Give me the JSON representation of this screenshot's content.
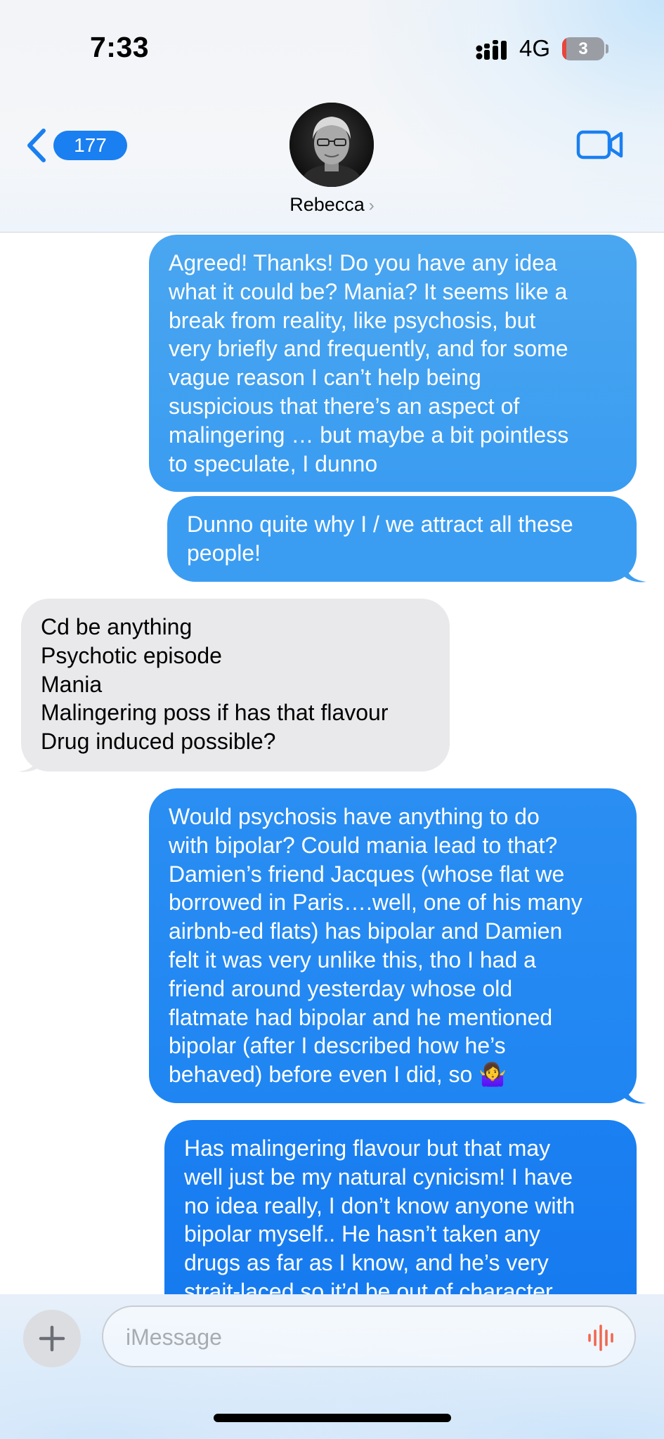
{
  "status_bar": {
    "time": "7:33",
    "network": "4G",
    "battery_level": "3",
    "signal_icon": "signal-bars-icon",
    "battery_icon": "battery-icon"
  },
  "header": {
    "back_count": "177",
    "back_icon": "chevron-left-icon",
    "contact_name": "Rebecca",
    "contact_chevron": "›",
    "video_icon": "video-camera-icon"
  },
  "messages": [
    {
      "direction": "outgoing",
      "text": "Agreed! Thanks! Do you have any idea\nwhat it could be? Mania? It seems like a\nbreak from reality, like psychosis, but\nvery briefly and frequently, and for some\nvague reason I can’t help being\nsuspicious that there’s an aspect of\nmalingering … but maybe a bit pointless\nto speculate, I dunno"
    },
    {
      "direction": "outgoing",
      "text": "Dunno quite why I / we attract all these\npeople!"
    },
    {
      "direction": "incoming",
      "text": "Cd be anything\nPsychotic episode\nMania\nMalingering poss if has that flavour\nDrug induced possible?"
    },
    {
      "direction": "outgoing",
      "text": "Would psychosis have anything to do\nwith bipolar? Could mania lead to that?\nDamien’s friend Jacques (whose flat we\nborrowed in Paris….well, one of his many\nairbnb-ed flats) has bipolar and Damien\nfelt it was very unlike this, tho I had a\nfriend around yesterday whose old\nflatmate had bipolar and he mentioned\nbipolar (after I described how he’s\nbehaved) before even I did, so 🤷‍♀️"
    },
    {
      "direction": "outgoing",
      "text": "Has malingering flavour but that may\nwell just be my natural cynicism! I have\nno idea really, I don’t know anyone with\nbipolar myself.. He hasn’t taken any\ndrugs as far as I know, and he’s very\nstrait-laced so it’d be out of character"
    }
  ],
  "composer": {
    "placeholder": "iMessage",
    "plus_icon": "plus-icon",
    "audio_icon": "audio-waveform-icon"
  },
  "colors": {
    "accent": "#1a7ff0",
    "incoming_bubble": "#e9e9eb",
    "audio_icon": "#f0674f"
  }
}
